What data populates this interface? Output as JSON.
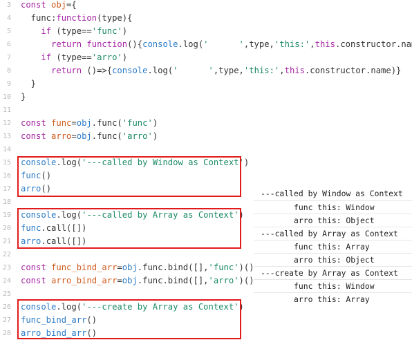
{
  "code": {
    "lines": [
      {
        "n": "3",
        "segs": [
          {
            "c": "kw",
            "t": "const "
          },
          {
            "c": "var",
            "t": "obj"
          },
          {
            "c": "pl",
            "t": "={"
          }
        ]
      },
      {
        "n": "4",
        "segs": [
          {
            "c": "pl",
            "t": "  func:"
          },
          {
            "c": "kw",
            "t": "function"
          },
          {
            "c": "pl",
            "t": "(type){"
          }
        ]
      },
      {
        "n": "5",
        "segs": [
          {
            "c": "pl",
            "t": "    "
          },
          {
            "c": "kw",
            "t": "if "
          },
          {
            "c": "pl",
            "t": "(type=="
          },
          {
            "c": "str",
            "t": "'func'"
          },
          {
            "c": "pl",
            "t": ")"
          }
        ]
      },
      {
        "n": "6",
        "segs": [
          {
            "c": "pl",
            "t": "      "
          },
          {
            "c": "kw",
            "t": "return function"
          },
          {
            "c": "pl",
            "t": "(){"
          },
          {
            "c": "fn",
            "t": "console"
          },
          {
            "c": "pl",
            "t": ".log("
          },
          {
            "c": "str",
            "t": "'      '"
          },
          {
            "c": "pl",
            "t": ",type,"
          },
          {
            "c": "str",
            "t": "'this:'"
          },
          {
            "c": "pl",
            "t": ","
          },
          {
            "c": "kw",
            "t": "this"
          },
          {
            "c": "pl",
            "t": ".constructor.name)}"
          }
        ]
      },
      {
        "n": "7",
        "segs": [
          {
            "c": "pl",
            "t": "    "
          },
          {
            "c": "kw",
            "t": "if "
          },
          {
            "c": "pl",
            "t": "(type=="
          },
          {
            "c": "str",
            "t": "'arro'"
          },
          {
            "c": "pl",
            "t": ")"
          }
        ]
      },
      {
        "n": "8",
        "segs": [
          {
            "c": "pl",
            "t": "      "
          },
          {
            "c": "kw",
            "t": "return "
          },
          {
            "c": "pl",
            "t": "()=>{"
          },
          {
            "c": "fn",
            "t": "console"
          },
          {
            "c": "pl",
            "t": ".log("
          },
          {
            "c": "str",
            "t": "'      '"
          },
          {
            "c": "pl",
            "t": ",type,"
          },
          {
            "c": "str",
            "t": "'this:'"
          },
          {
            "c": "pl",
            "t": ","
          },
          {
            "c": "kw",
            "t": "this"
          },
          {
            "c": "pl",
            "t": ".constructor.name)}"
          }
        ]
      },
      {
        "n": "9",
        "segs": [
          {
            "c": "pl",
            "t": "  }"
          }
        ]
      },
      {
        "n": "10",
        "segs": [
          {
            "c": "pl",
            "t": "}"
          }
        ]
      },
      {
        "n": "11",
        "segs": []
      },
      {
        "n": "12",
        "segs": [
          {
            "c": "kw",
            "t": "const "
          },
          {
            "c": "var",
            "t": "func"
          },
          {
            "c": "pl",
            "t": "="
          },
          {
            "c": "fn",
            "t": "obj"
          },
          {
            "c": "pl",
            "t": ".func("
          },
          {
            "c": "str",
            "t": "'func'"
          },
          {
            "c": "pl",
            "t": ")"
          }
        ]
      },
      {
        "n": "13",
        "segs": [
          {
            "c": "kw",
            "t": "const "
          },
          {
            "c": "var",
            "t": "arro"
          },
          {
            "c": "pl",
            "t": "="
          },
          {
            "c": "fn",
            "t": "obj"
          },
          {
            "c": "pl",
            "t": ".func("
          },
          {
            "c": "str",
            "t": "'arro'"
          },
          {
            "c": "pl",
            "t": ")"
          }
        ]
      },
      {
        "n": "14",
        "segs": []
      },
      {
        "n": "15",
        "segs": [
          {
            "c": "fn",
            "t": "console"
          },
          {
            "c": "pl",
            "t": ".log("
          },
          {
            "c": "str",
            "t": "'---called by Window as Context'"
          },
          {
            "c": "pl",
            "t": ")"
          }
        ]
      },
      {
        "n": "16",
        "segs": [
          {
            "c": "fn",
            "t": "func"
          },
          {
            "c": "pl",
            "t": "()"
          }
        ]
      },
      {
        "n": "17",
        "segs": [
          {
            "c": "fn",
            "t": "arro"
          },
          {
            "c": "pl",
            "t": "()"
          }
        ]
      },
      {
        "n": "18",
        "segs": []
      },
      {
        "n": "19",
        "segs": [
          {
            "c": "fn",
            "t": "console"
          },
          {
            "c": "pl",
            "t": ".log("
          },
          {
            "c": "str",
            "t": "'---called by Array as Context'"
          },
          {
            "c": "pl",
            "t": ")"
          }
        ]
      },
      {
        "n": "20",
        "segs": [
          {
            "c": "fn",
            "t": "func"
          },
          {
            "c": "pl",
            "t": ".call([])"
          }
        ]
      },
      {
        "n": "21",
        "segs": [
          {
            "c": "fn",
            "t": "arro"
          },
          {
            "c": "pl",
            "t": ".call([])"
          }
        ]
      },
      {
        "n": "22",
        "segs": []
      },
      {
        "n": "23",
        "segs": [
          {
            "c": "kw",
            "t": "const "
          },
          {
            "c": "var",
            "t": "func_bind_arr"
          },
          {
            "c": "pl",
            "t": "="
          },
          {
            "c": "fn",
            "t": "obj"
          },
          {
            "c": "pl",
            "t": ".func.bind([],"
          },
          {
            "c": "str",
            "t": "'func'"
          },
          {
            "c": "pl",
            "t": ")()"
          }
        ]
      },
      {
        "n": "24",
        "segs": [
          {
            "c": "kw",
            "t": "const "
          },
          {
            "c": "var",
            "t": "arro_bind_arr"
          },
          {
            "c": "pl",
            "t": "="
          },
          {
            "c": "fn",
            "t": "obj"
          },
          {
            "c": "pl",
            "t": ".func.bind([],"
          },
          {
            "c": "str",
            "t": "'arro'"
          },
          {
            "c": "pl",
            "t": ")()"
          }
        ]
      },
      {
        "n": "25",
        "segs": []
      },
      {
        "n": "26",
        "segs": [
          {
            "c": "fn",
            "t": "console"
          },
          {
            "c": "pl",
            "t": ".log("
          },
          {
            "c": "str",
            "t": "'---create by Array as Context'"
          },
          {
            "c": "pl",
            "t": ")"
          }
        ]
      },
      {
        "n": "27",
        "segs": [
          {
            "c": "fn",
            "t": "func_bind_arr"
          },
          {
            "c": "pl",
            "t": "()"
          }
        ]
      },
      {
        "n": "28",
        "segs": [
          {
            "c": "fn",
            "t": "arro_bind_arr"
          },
          {
            "c": "pl",
            "t": "()"
          }
        ]
      }
    ]
  },
  "output": {
    "rows": [
      {
        "text": "---called by Window as Context",
        "indent": false
      },
      {
        "text": "func this: Window",
        "indent": true
      },
      {
        "text": "arro this: Object",
        "indent": true
      },
      {
        "text": "---called by Array as Context",
        "indent": false
      },
      {
        "text": "func this: Array",
        "indent": true
      },
      {
        "text": "arro this: Object",
        "indent": true
      },
      {
        "text": "---create by Array as Context",
        "indent": false
      },
      {
        "text": "func this: Window",
        "indent": true
      },
      {
        "text": "arro this: Array",
        "indent": true
      }
    ]
  },
  "colors": {
    "highlight_border": "#e11b1b",
    "keyword": "#a626a4",
    "variable": "#d05a1c",
    "string": "#1a8a64",
    "identifier": "#2b7bc6"
  }
}
